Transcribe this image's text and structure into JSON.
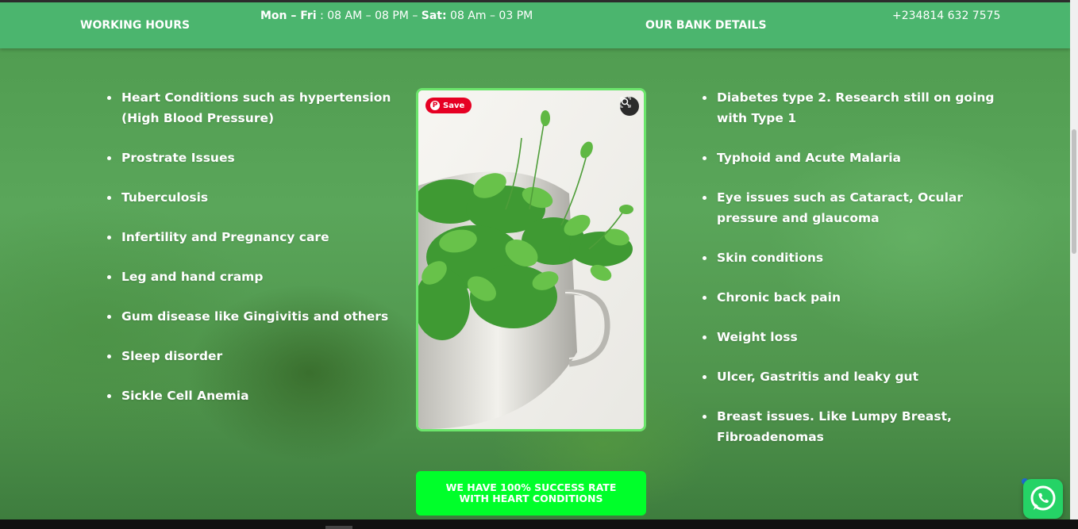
{
  "topbar": {
    "working_hours_label": "WORKING HOURS",
    "hours": {
      "weekday_label": "Mon – Fri",
      "weekday_value": " : 08 AM – 08 PM – ",
      "sat_label": "Sat:",
      "sat_value": " 08 Am – 03 PM"
    },
    "bank_label": "OUR BANK DETAILS",
    "phone": "+234814 632 7575"
  },
  "left_conditions": [
    "Heart Conditions such as hypertension (High Blood Pressure)",
    "Prostrate Issues",
    "Tuberculosis",
    "Infertility and Pregnancy care",
    "Leg and hand cramp",
    "Gum disease like Gingivitis and others",
    "Sleep disorder",
    "Sickle Cell Anemia"
  ],
  "right_conditions": [
    "Diabetes type 2. Research still on going with Type 1",
    "Typhoid and Acute Malaria",
    "Eye issues such as Cataract, Ocular pressure and glaucoma",
    "Skin conditions",
    "Chronic back pain",
    "Weight loss",
    "Ulcer, Gastritis and leaky gut",
    "Breast issues. Like Lumpy Breast, Fibroadenomas"
  ],
  "photo": {
    "save_label": "Save",
    "pin_icon": "pinterest-icon",
    "lens_icon": "visual-search-icon"
  },
  "cta": {
    "line1": "WE HAVE 100% SUCCESS RATE",
    "line2": "WITH HEART CONDITIONS"
  },
  "colors": {
    "topbar": "#4bb56e",
    "cta": "#00ff2a",
    "photo_border": "#6be56b",
    "pinterest": "#e60023",
    "whatsapp": "#25d366"
  },
  "whatsapp": {
    "icon": "whatsapp-icon"
  }
}
